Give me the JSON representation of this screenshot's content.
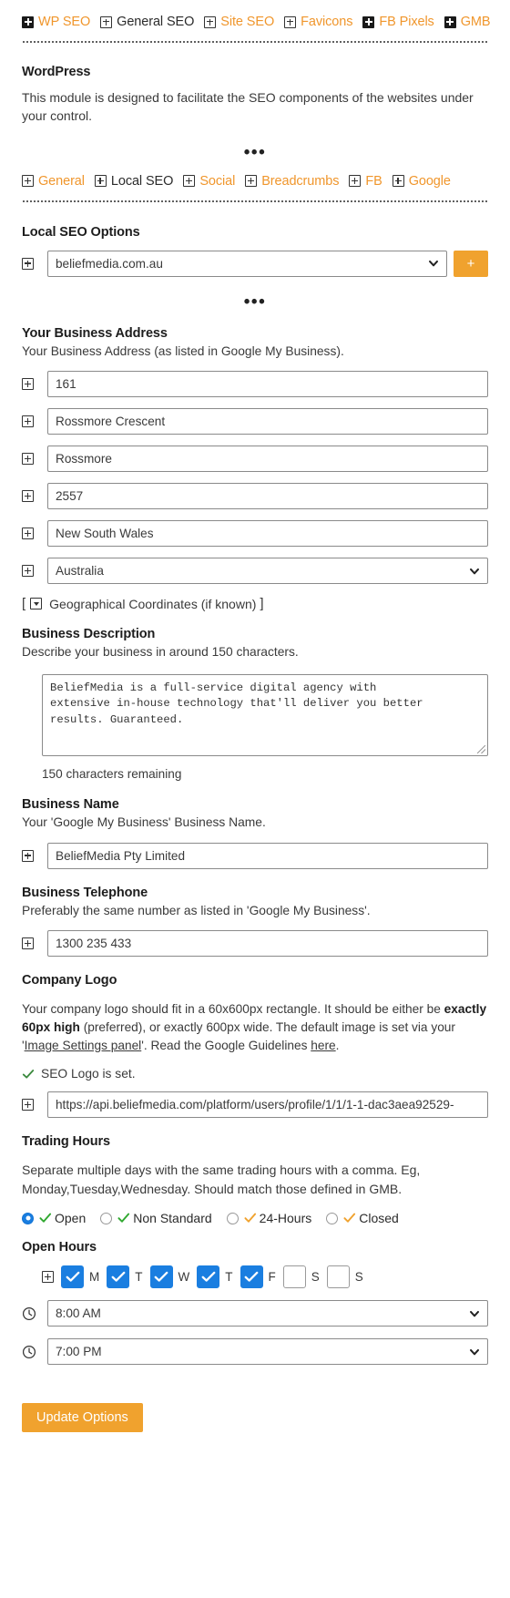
{
  "top_nav": {
    "items": [
      {
        "label": "WP SEO",
        "icon": "plus-filled",
        "color": "orange"
      },
      {
        "label": "General SEO",
        "icon": "plus-outline",
        "color": "dark"
      },
      {
        "label": "Site SEO",
        "icon": "plus-outline",
        "color": "orange"
      },
      {
        "label": "Favicons",
        "icon": "plus-outline",
        "color": "orange"
      },
      {
        "label": "FB Pixels",
        "icon": "plus-filled",
        "color": "orange"
      },
      {
        "label": "GMB",
        "icon": "plus-filled",
        "color": "orange"
      }
    ]
  },
  "module": {
    "title": "WordPress",
    "description": "This module is designed to facilitate the SEO components of the websites under your control.",
    "ellipsis": "•••"
  },
  "sub_nav": {
    "items": [
      {
        "label": "General",
        "icon": "plus-outline",
        "color": "orange"
      },
      {
        "label": "Local SEO",
        "icon": "plus-outline",
        "color": "dark"
      },
      {
        "label": "Social",
        "icon": "plus-outline",
        "color": "orange"
      },
      {
        "label": "Breadcrumbs",
        "icon": "plus-outline",
        "color": "orange"
      },
      {
        "label": "FB",
        "icon": "plus-outline",
        "color": "orange"
      },
      {
        "label": "Google",
        "icon": "plus-outline",
        "color": "orange"
      }
    ]
  },
  "local_seo": {
    "title": "Local SEO Options",
    "site_select_value": "beliefmedia.com.au",
    "add_button_label": "+"
  },
  "business_address": {
    "title": "Your Business Address",
    "subtitle": "Your Business Address (as listed in Google My Business).",
    "street_number": "161",
    "street_name": "Rossmore Crescent",
    "suburb": "Rossmore",
    "postcode": "2557",
    "state": "New South Wales",
    "country": "Australia",
    "coordinates_label": "Geographical Coordinates (if known)",
    "bracket_open": "[",
    "bracket_close": "]"
  },
  "business_description": {
    "title": "Business Description",
    "subtitle": "Describe your business in around 150 characters.",
    "value": "BeliefMedia is a full-service digital agency with\nextensive in-house technology that'll deliver you better\nresults. Guaranteed.",
    "remaining": "150 characters remaining"
  },
  "business_name": {
    "title": "Business Name",
    "subtitle": "Your 'Google My Business' Business Name.",
    "value": "BeliefMedia Pty Limited"
  },
  "business_telephone": {
    "title": "Business Telephone",
    "subtitle": "Preferably the same number as listed in 'Google My Business'.",
    "value": "1300 235 433"
  },
  "company_logo": {
    "title": "Company Logo",
    "text_1": "Your company logo should fit in a 60x600px rectangle. It should be either be ",
    "text_bold": "exactly 60px high",
    "text_2": " (preferred), or exactly 600px wide. The default image is set via your '",
    "link_1": "Image Settings panel",
    "text_3": "'. Read the Google Guidelines ",
    "link_2": "here",
    "text_4": ".",
    "status": "SEO Logo is set.",
    "status_color": "#3c8a3f",
    "url_value": "https://api.beliefmedia.com/platform/users/profile/1/1/1-1-dac3aea92529-"
  },
  "trading_hours": {
    "title": "Trading Hours",
    "description": "Separate multiple days with the same trading hours with a comma. Eg, Monday,Tuesday,Wednesday. Should match those defined in GMB.",
    "options": [
      {
        "label": "Open",
        "selected": true,
        "check_color": "#2fa82f"
      },
      {
        "label": "Non Standard",
        "selected": false,
        "check_color": "#2fa82f"
      },
      {
        "label": "24-Hours",
        "selected": false,
        "check_color": "#f0a22e"
      },
      {
        "label": "Closed",
        "selected": false,
        "check_color": "#f0a22e"
      }
    ]
  },
  "open_hours": {
    "title": "Open Hours",
    "days": [
      {
        "label": "M",
        "checked": true
      },
      {
        "label": "T",
        "checked": true
      },
      {
        "label": "W",
        "checked": true
      },
      {
        "label": "T",
        "checked": true
      },
      {
        "label": "F",
        "checked": true
      },
      {
        "label": "S",
        "checked": false
      },
      {
        "label": "S",
        "checked": false
      }
    ],
    "open_time": "8:00 AM",
    "close_time": "7:00 PM"
  },
  "footer": {
    "update_button": "Update Options"
  },
  "colors": {
    "accent_orange": "#f0a22e",
    "link_orange": "#f0962c",
    "checkbox_blue": "#1a7ee0",
    "green": "#2fa82f"
  }
}
